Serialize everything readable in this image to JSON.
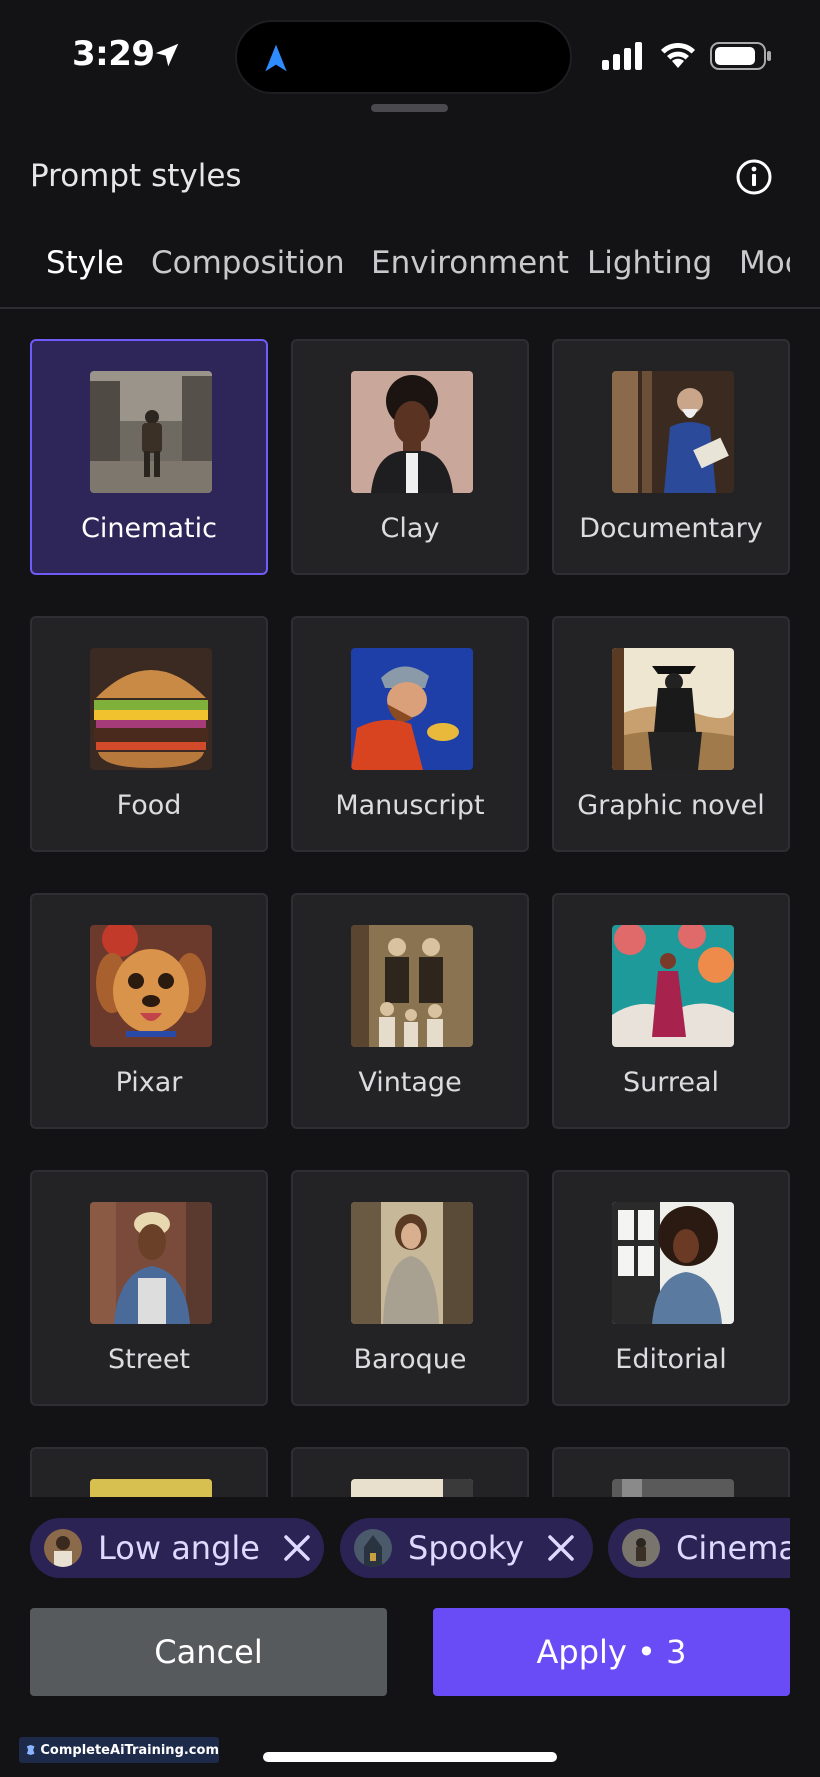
{
  "status_bar": {
    "time": "3:29"
  },
  "header": {
    "title": "Prompt styles"
  },
  "tabs": [
    {
      "label": "Style",
      "active": true
    },
    {
      "label": "Composition",
      "active": false
    },
    {
      "label": "Environment",
      "active": false
    },
    {
      "label": "Lighting",
      "active": false
    },
    {
      "label": "Mood",
      "active": false
    }
  ],
  "styles": [
    {
      "label": "Cinematic",
      "selected": true
    },
    {
      "label": "Clay",
      "selected": false
    },
    {
      "label": "Documentary",
      "selected": false
    },
    {
      "label": "Food",
      "selected": false
    },
    {
      "label": "Manuscript",
      "selected": false
    },
    {
      "label": "Graphic novel",
      "selected": false
    },
    {
      "label": "Pixar",
      "selected": false
    },
    {
      "label": "Vintage",
      "selected": false
    },
    {
      "label": "Surreal",
      "selected": false
    },
    {
      "label": "Street",
      "selected": false
    },
    {
      "label": "Baroque",
      "selected": false
    },
    {
      "label": "Editorial",
      "selected": false
    }
  ],
  "selected_chips": [
    {
      "label": "Low angle"
    },
    {
      "label": "Spooky"
    },
    {
      "label": "Cinematic"
    }
  ],
  "actions": {
    "cancel_label": "Cancel",
    "apply_label": "Apply • 3"
  },
  "watermark": {
    "text": "CompleteAiTraining.com"
  },
  "colors": {
    "background": "#131315",
    "card": "#232326",
    "selected_card": "#2e2558",
    "accent": "#6a4cf6",
    "chip": "#2b2354",
    "cancel": "#575a5c"
  }
}
